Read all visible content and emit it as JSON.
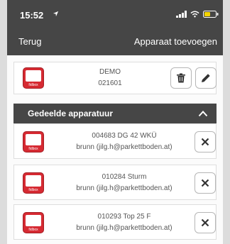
{
  "status_bar": {
    "time": "15:52"
  },
  "nav": {
    "back_label": "Terug",
    "add_label": "Apparaat toevoegen"
  },
  "own_device": {
    "name": "DEMO",
    "id": "021601"
  },
  "shared_section": {
    "title": "Gedeelde apparatuur"
  },
  "shared_devices": [
    {
      "name": "004683 DG 42 WKÜ",
      "owner": "brunn (jilg.h@parkettboden.at)"
    },
    {
      "name": "010284 Sturm",
      "owner": "brunn (jilg.h@parkettboden.at)"
    },
    {
      "name": "010293 Top 25 F",
      "owner": "brunn (jilg.h@parkettboden.at)"
    }
  ],
  "logo_text": "fidbox",
  "colors": {
    "header": "#464646",
    "logo": "#d62a32",
    "battery": "#f5d400"
  }
}
